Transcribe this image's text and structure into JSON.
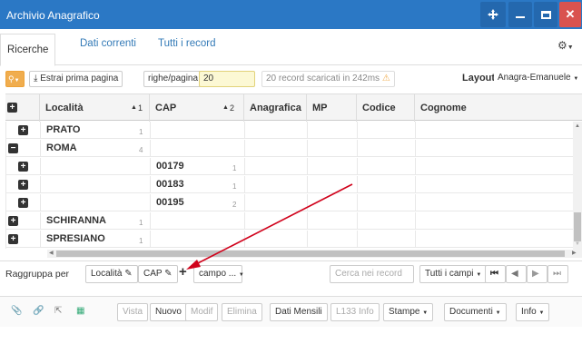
{
  "window": {
    "title": "Archivio Anagrafico"
  },
  "tabs": [
    "Ricerche",
    "Dati correnti",
    "Tutti i record"
  ],
  "toolbar": {
    "extract": "Estrai prima pagina",
    "rows_label": "righe/pagina",
    "rows_value": "20",
    "status": "20 record scaricati in 242ms",
    "layout_label": "Layout",
    "layout_value": "Anagra-Emanuele"
  },
  "columns": {
    "localita": "Località",
    "sort1": "1",
    "cap": "CAP",
    "sort2": "2",
    "anagrafica": "Anagrafica",
    "mp": "MP",
    "codice": "Codice",
    "cognome": "Cognome"
  },
  "rows": [
    {
      "icon": "plus",
      "localita": "PRATO",
      "loc_count": "1",
      "cap": "",
      "cap_count": ""
    },
    {
      "icon": "minus",
      "localita": "ROMA",
      "loc_count": "4",
      "cap": "",
      "cap_count": ""
    },
    {
      "icon": "plus",
      "localita": "",
      "loc_count": "",
      "cap": "00179",
      "cap_count": "1"
    },
    {
      "icon": "plus",
      "localita": "",
      "loc_count": "",
      "cap": "00183",
      "cap_count": "1"
    },
    {
      "icon": "plus",
      "localita": "",
      "loc_count": "",
      "cap": "00195",
      "cap_count": "2"
    },
    {
      "icon": "plus",
      "localita": "SCHIRANNA",
      "loc_count": "1",
      "cap": "",
      "cap_count": ""
    },
    {
      "icon": "plus",
      "localita": "SPRESIANO",
      "loc_count": "1",
      "cap": "",
      "cap_count": ""
    }
  ],
  "groupby": {
    "label": "Raggruppa per",
    "chip1": "Località",
    "chip2": "CAP",
    "field": "campo ...",
    "search_placeholder": "Cerca nei record",
    "all_fields": "Tutti i campi"
  },
  "actions": {
    "vista": "Vista",
    "nuovo": "Nuovo",
    "modif": "Modif",
    "elimina": "Elimina",
    "dati_mensili": "Dati Mensili",
    "l133": "L133 Info",
    "stampe": "Stampe",
    "documenti": "Documenti",
    "info": "Info"
  },
  "colors": {
    "titlebar": "#2b78c5",
    "close": "#d9534f",
    "search": "#f0ad4e",
    "arrow": "#d0021b"
  }
}
